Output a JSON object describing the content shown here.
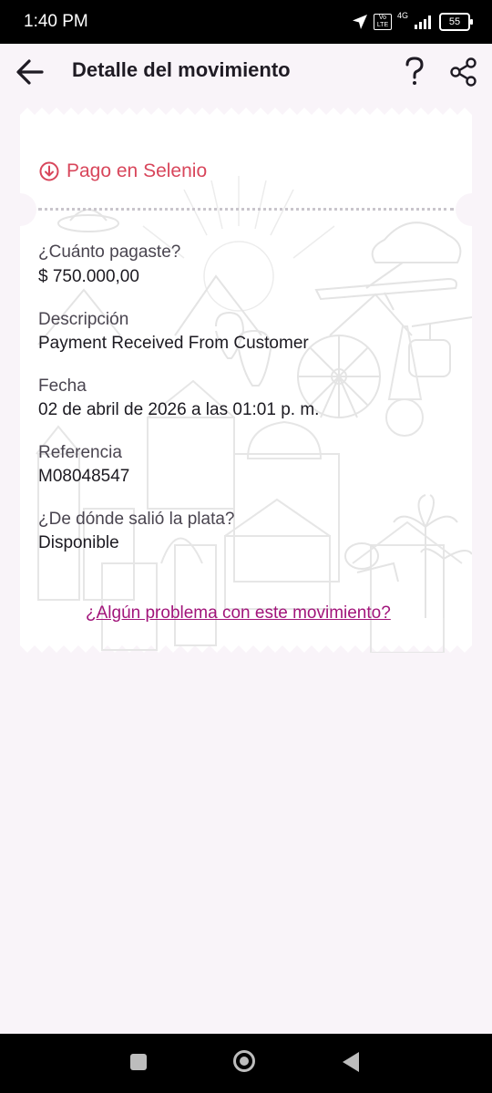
{
  "status_bar": {
    "time": "1:40 PM",
    "network": "4G",
    "volte": "Vo LTE",
    "battery": "55"
  },
  "header": {
    "title": "Detalle del movimiento",
    "icons": [
      "back-arrow-icon",
      "help-icon",
      "share-icon"
    ]
  },
  "movement": {
    "type": "Pago en Selenio",
    "fields": [
      {
        "label": "¿Cuánto pagaste?",
        "value": "$ 750.000,00"
      },
      {
        "label": "Descripción",
        "value": "Payment Received From Customer"
      },
      {
        "label": "Fecha",
        "value": "02 de abril de 2026 a las 01:01 p. m."
      },
      {
        "label": "Referencia",
        "value": "M08048547"
      },
      {
        "label": "¿De dónde salió la plata?",
        "value": "Disponible"
      }
    ],
    "problem_link": "¿Algún problema con este movimiento?"
  },
  "colors": {
    "accent": "#d8465b",
    "link": "#a1147a",
    "background": "#f9f4f9"
  }
}
